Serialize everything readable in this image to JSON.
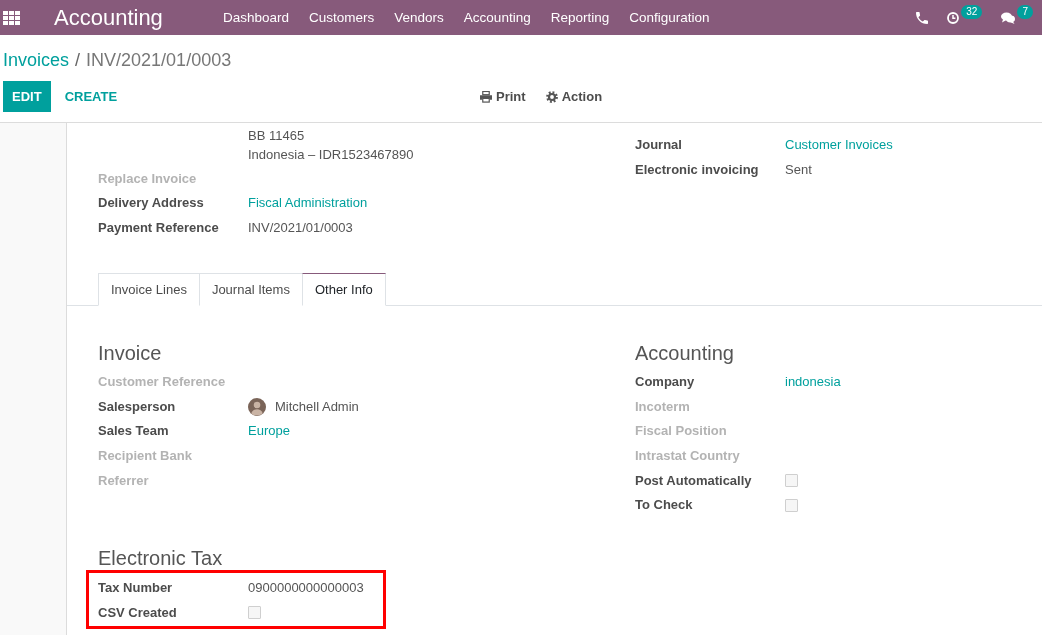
{
  "navbar": {
    "brand": "Accounting",
    "menu": [
      "Dashboard",
      "Customers",
      "Vendors",
      "Accounting",
      "Reporting",
      "Configuration"
    ],
    "systray": [
      {
        "kind": "phone"
      },
      {
        "kind": "activity",
        "badge": "32"
      },
      {
        "kind": "chat",
        "badge": "7"
      }
    ]
  },
  "breadcrumb": {
    "parent": "Invoices",
    "separator": "/",
    "current": "INV/2021/01/0003"
  },
  "actions": {
    "edit": "EDIT",
    "create": "CREATE"
  },
  "toolbar": [
    {
      "kind": "print",
      "label": "Print"
    },
    {
      "kind": "action",
      "label": "Action"
    }
  ],
  "header": {
    "address_lines": [
      "BB 11465",
      "Indonesia – IDR1523467890"
    ],
    "left_fields": [
      {
        "label": "Replace Invoice",
        "kind": "blank"
      },
      {
        "label": "Delivery Address",
        "kind": "link",
        "value": "Fiscal Administration"
      },
      {
        "label": "Payment Reference",
        "kind": "text",
        "value": "INV/2021/01/0003"
      }
    ],
    "right_fields": [
      {
        "label": "Journal",
        "kind": "link",
        "value": "Customer Invoices"
      },
      {
        "label": "Electronic invoicing",
        "kind": "text",
        "value": "Sent"
      }
    ]
  },
  "tabs": [
    {
      "label": "Invoice Lines",
      "selected": false
    },
    {
      "label": "Journal Items",
      "selected": false
    },
    {
      "label": "Other Info",
      "selected": true
    }
  ],
  "sections": [
    {
      "title": "Invoice",
      "fields": [
        {
          "label": "Customer Reference",
          "kind": "blank"
        },
        {
          "label": "Salesperson",
          "kind": "user",
          "value": "Mitchell Admin"
        },
        {
          "label": "Sales Team",
          "kind": "link",
          "value": "Europe"
        },
        {
          "label": "Recipient Bank",
          "kind": "blank"
        },
        {
          "label": "Referrer",
          "kind": "blank"
        }
      ]
    },
    {
      "title": "Accounting",
      "fields": [
        {
          "label": "Company",
          "kind": "link",
          "value": "indonesia"
        },
        {
          "label": "Incoterm",
          "kind": "blank"
        },
        {
          "label": "Fiscal Position",
          "kind": "blank"
        },
        {
          "label": "Intrastat Country",
          "kind": "blank"
        },
        {
          "label": "Post Automatically",
          "kind": "checkbox",
          "checked": false
        },
        {
          "label": "To Check",
          "kind": "checkbox",
          "checked": false
        }
      ]
    }
  ],
  "electronic_tax": {
    "title": "Electronic Tax",
    "highlighted": true,
    "fields": [
      {
        "label": "Tax Number",
        "kind": "text",
        "value": "0900000000000003"
      },
      {
        "label": "CSV Created",
        "kind": "checkbox",
        "checked": false
      }
    ]
  }
}
